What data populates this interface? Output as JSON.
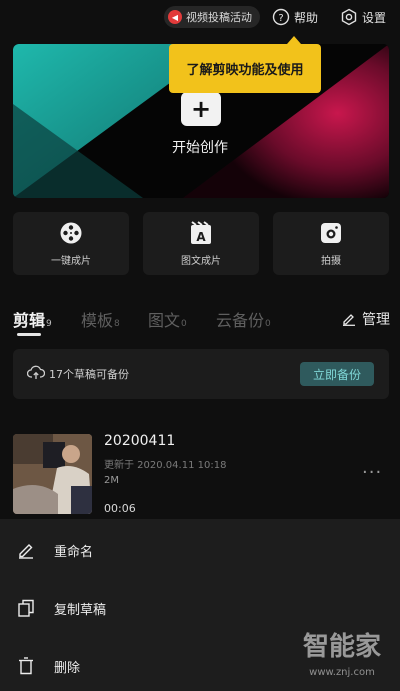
{
  "topbar": {
    "promo_label": "视频投稿活动",
    "promo_icon": "megaphone-icon",
    "help_label": "帮助",
    "help_icon": "question-circle-icon",
    "settings_label": "设置",
    "settings_icon": "gear-icon"
  },
  "hero": {
    "plus_symbol": "+",
    "label": "开始创作",
    "colors": {
      "teal": "#1aa59c",
      "magenta": "#a3133f"
    }
  },
  "tooltip": {
    "text": "了解剪映功能及使用"
  },
  "quick_actions": [
    {
      "label": "一键成片",
      "icon": "film-reel-icon"
    },
    {
      "label": "图文成片",
      "icon": "text-clapper-icon"
    },
    {
      "label": "拍摄",
      "icon": "camera-icon"
    }
  ],
  "tabs": [
    {
      "label": "剪辑",
      "count": "9",
      "active": true
    },
    {
      "label": "模板",
      "count": "8",
      "active": false
    },
    {
      "label": "图文",
      "count": "0",
      "active": false
    },
    {
      "label": "云备份",
      "count": "0",
      "active": false
    }
  ],
  "manage_label": "管理",
  "backup": {
    "text": "17个草稿可备份",
    "button_label": "立即备份",
    "accent": "#2f5a5d"
  },
  "draft": {
    "title": "20200411",
    "updated": "更新于 2020.04.11 10:18",
    "size": "2M",
    "duration": "00:06",
    "more_label": "···"
  },
  "menu": [
    {
      "label": "重命名",
      "icon": "pencil-icon"
    },
    {
      "label": "复制草稿",
      "icon": "copy-icon"
    },
    {
      "label": "删除",
      "icon": "trash-icon"
    }
  ],
  "watermark": {
    "brand": "智能家",
    "url": "www.znj.com"
  }
}
